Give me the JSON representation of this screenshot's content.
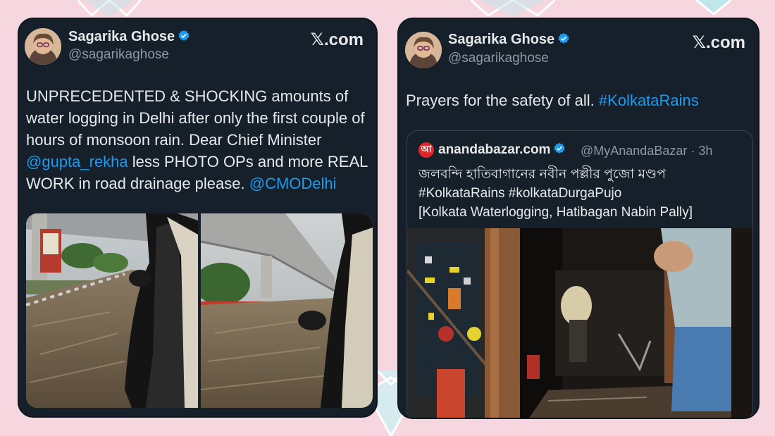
{
  "colors": {
    "background": "#f6d7df",
    "card": "#15202b",
    "link": "#1d9bf0",
    "verified": "#1d9bf0",
    "muted_text": "#8b98a5"
  },
  "left_post": {
    "author": {
      "name": "Sagarika Ghose",
      "handle": "@sagarikaghose",
      "avatar_icon": "avatar",
      "verified_icon": "verified-badge-icon"
    },
    "source_label": "𝕏.com",
    "text_parts": [
      {
        "text": "UNPRECEDENTED & SHOCKING amounts of water logging in Delhi after only the first couple of hours of monsoon rain. Dear Chief Minister ",
        "kind": "plain"
      },
      {
        "text": "@gupta_rekha",
        "kind": "mention"
      },
      {
        "text": " less PHOTO OPs and more REAL WORK in road drainage please. ",
        "kind": "plain"
      },
      {
        "text": "@CMODelhi",
        "kind": "mention"
      }
    ],
    "media": [
      "flooded road under flyover seen from car window",
      "flooded road under flyover seen from car window"
    ]
  },
  "right_post": {
    "author": {
      "name": "Sagarika Ghose",
      "handle": "@sagarikaghose",
      "avatar_icon": "avatar",
      "verified_icon": "verified-badge-icon"
    },
    "source_label": "𝕏.com",
    "text_plain": "Prayers for the safety of all. ",
    "hashtag": "#KolkataRains",
    "quote": {
      "logo_text": "আ",
      "name": "anandabazar.com",
      "handle_time": "@MyAnandaBazar · 3h",
      "line1": "জলবন্দি হাতিবাগানের নবীন পল্লীর পুজো মণ্ডপ",
      "line2": "#KolkataRains #kolkataDurgaPujo",
      "line3": "[Kolkata Waterlogging, Hatibagan Nabin Pally]",
      "media": "waterlogged pandal entrance with electrical panel"
    }
  }
}
